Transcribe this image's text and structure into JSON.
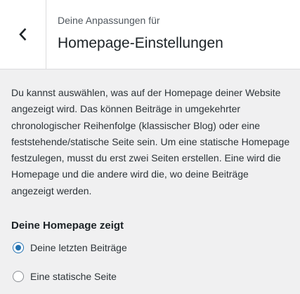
{
  "header": {
    "subtitle": "Deine Anpassungen für",
    "title": "Homepage-Einstellungen",
    "back_icon": "chevron-left-icon"
  },
  "description": {
    "text": "Du kannst auswählen, was auf der Homepage deiner Website angezeigt wird. Das können Beiträge in umgekehrter chronologischer Reihenfolge (klassischer Blog) oder eine feststehende/statische Seite sein. Um eine statische Homepage festzulegen, musst du erst zwei Seiten erstellen. Eine wird die Homepage und die andere wird die, wo deine Beiträge angezeigt werden."
  },
  "homepage_setting": {
    "label": "Deine Homepage zeigt",
    "options": [
      {
        "label": "Deine letzten Beiträge",
        "selected": true
      },
      {
        "label": "Eine statische Seite",
        "selected": false
      }
    ]
  },
  "colors": {
    "accent": "#2271b1",
    "panel_background": "#f0f0f1",
    "header_background": "#ffffff"
  }
}
